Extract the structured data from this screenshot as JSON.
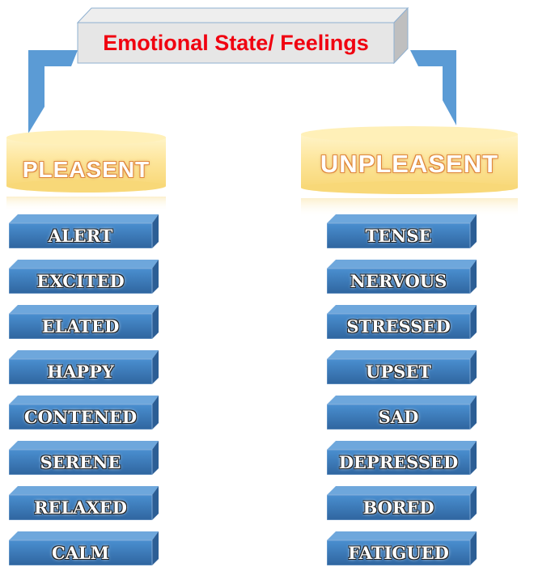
{
  "title": "Emotional State/ Feelings",
  "categories": {
    "pleasant": {
      "label": "PLEASENT",
      "items": [
        "ALERT",
        "EXCITED",
        "ELATED",
        "HAPPY",
        "CONTENED",
        "SERENE",
        "RELAXED",
        "CALM"
      ]
    },
    "unpleasant": {
      "label": "UNPLEASENT",
      "items": [
        "TENSE",
        "NERVOUS",
        "STRESSED",
        "UPSET",
        "SAD",
        "DEPRESSED",
        "BORED",
        "FATIGUED"
      ]
    }
  },
  "colors": {
    "title_text": "#f00010",
    "connector": "#5b9bd5",
    "box": "#3f80c0",
    "cylinder": "#fde9a0"
  }
}
